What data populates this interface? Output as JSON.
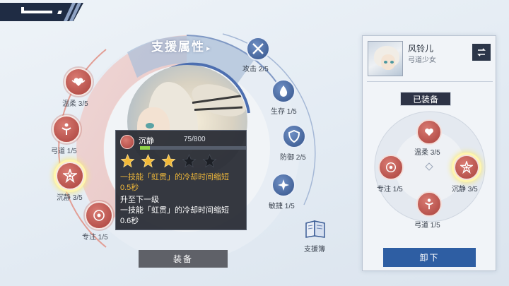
{
  "header": {
    "back_icon": "back-arrow-icon"
  },
  "attribute_panel": {
    "title": "支援属性",
    "title_chevron": "▸"
  },
  "left_nodes": [
    {
      "label": "温柔 3/5",
      "icon": "heart-wings-icon",
      "selected": false
    },
    {
      "label": "弓道 1/5",
      "icon": "archer-figure-icon",
      "selected": false
    },
    {
      "label": "沉静 3/5",
      "icon": "calm-burst-icon",
      "selected": true
    },
    {
      "label": "专注 1/5",
      "icon": "focus-target-icon",
      "selected": false
    }
  ],
  "stats": [
    {
      "label": "攻击 2/5",
      "icon": "crossed-swords-icon"
    },
    {
      "label": "生存 1/5",
      "icon": "water-drop-icon"
    },
    {
      "label": "防御 2/5",
      "icon": "shield-icon"
    },
    {
      "label": "敏捷 1/5",
      "icon": "agility-star-icon"
    }
  ],
  "tooltip": {
    "name": "沉静",
    "exp": "75/800",
    "exp_fraction": 0.09375,
    "stars_filled": 3,
    "stars_total": 5,
    "current_effect_line1": "一技能「虹贯」的冷却时间缩短",
    "current_effect_line2": "0.5秒",
    "next_level_title": "升至下一级",
    "next_effect_line1": "一技能「虹贯」的冷却时间缩短",
    "next_effect_line2": "0.6秒"
  },
  "equip_button": {
    "label": "装备"
  },
  "support_book": {
    "label": "支援簿",
    "icon": "book-icon"
  },
  "character_panel": {
    "name": "风铃儿",
    "class": "弓道少女",
    "swap_icon": "swap-icon",
    "equipped_label": "已装备",
    "equipped_nodes": [
      {
        "label": "温柔 3/5",
        "icon": "heart-wings-icon",
        "selected": false
      },
      {
        "label": "专注 1/5",
        "icon": "focus-target-icon",
        "selected": false
      },
      {
        "label": "沉静 3/5",
        "icon": "calm-burst-icon",
        "selected": true
      },
      {
        "label": "弓道 1/5",
        "icon": "archer-figure-icon",
        "selected": false
      }
    ],
    "unequip_label": "卸下"
  },
  "colors": {
    "node_red": "#a9413c",
    "stat_blue": "#34538a",
    "exp_green": "#8fd24a",
    "star_gold": "#f1b93a",
    "unequip_blue": "#2e5ea3"
  }
}
